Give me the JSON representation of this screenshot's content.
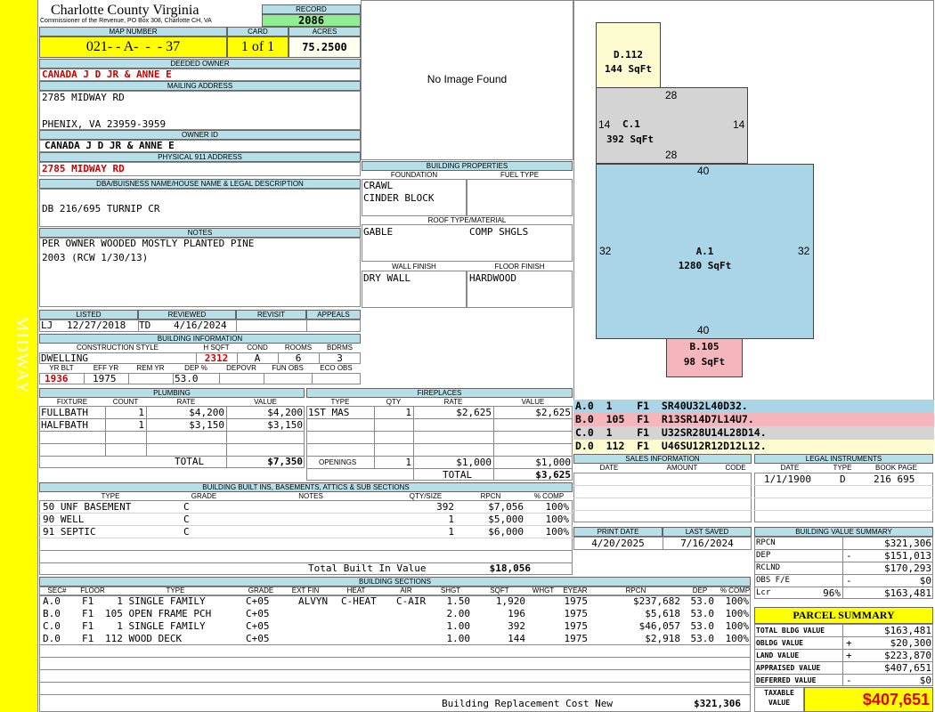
{
  "side_label": "MIDWAY",
  "header": {
    "county": "Charlotte County Virginia",
    "commissioner": "Commissioner of the Revenue, PO Box 308, Charlotte CH, VA",
    "record_label": "RECORD",
    "record": "2086",
    "map_number_label": "MAP NUMBER",
    "map_number": "021- - A-  -  - 37",
    "card_label": "CARD",
    "card": "1 of 1",
    "acres_label": "ACRES",
    "acres": "75.2500"
  },
  "owner": {
    "deeded_owner_label": "DEEDED OWNER",
    "deeded_owner": "CANADA J D JR & ANNE E",
    "mailing_label": "MAILING ADDRESS",
    "mailing_line1": "2785 MIDWAY RD",
    "mailing_line2": "PHENIX, VA 23959-3959",
    "owner_id_label": "OWNER ID",
    "owner_id": "CANADA J D JR & ANNE E",
    "physical_label": "PHYSICAL 911 ADDRESS",
    "physical": "2785 MIDWAY RD",
    "dba_label": "DBA/BUISNESS NAME/HOUSE NAME & LEGAL DESCRIPTION",
    "dba": "DB 216/695 TURNIP CR",
    "notes_label": "NOTES",
    "notes_line1": "PER OWNER WOODED MOSTLY PLANTED PINE",
    "notes_line2": "2003 (RCW 1/30/13)"
  },
  "image_text": "No Image Found",
  "listing": {
    "listed_label": "LISTED",
    "reviewed_label": "REVIEWED",
    "revisit_label": "REVISIT",
    "appeals_label": "APPEALS",
    "listed_by": "LJ",
    "listed_date": "12/27/2018",
    "reviewed_by": "TD",
    "reviewed_date": "4/16/2024"
  },
  "building_info": {
    "label": "BUILDING INFORMATION",
    "style_label": "CONSTRUCTION STYLE",
    "hsqft_label": "H SQFT",
    "cond_label": "COND",
    "rooms_label": "ROOMS",
    "bdrms_label": "BDRMS",
    "style": "DWELLING",
    "hsqft": "2312",
    "cond": "A",
    "rooms": "6",
    "bdrms": "3",
    "yrblt_label": "YR BLT",
    "effyr_label": "EFF YR",
    "remyr_label": "REM YR",
    "dep_label": "DEP %",
    "depovr_label": "DEPOVR",
    "funobs_label": "FUN OBS",
    "ecoobs_label": "ECO OBS",
    "yrblt": "1936",
    "effyr": "1975",
    "dep": "53.0"
  },
  "building_props": {
    "label": "BUILDING PROPERTIES",
    "foundation_label": "FOUNDATION",
    "fuel_label": "FUEL TYPE",
    "foundation1": "CRAWL",
    "foundation2": "CINDER BLOCK",
    "roof_label": "ROOF TYPE/MATERIAL",
    "roof_type": "GABLE",
    "roof_material": "COMP SHGLS",
    "wall_label": "WALL FINISH",
    "floor_label": "FLOOR FINISH",
    "wall": "DRY WALL",
    "floor": "HARDWOOD"
  },
  "plumbing": {
    "label": "PLUMBING",
    "headers": [
      "FIXTURE",
      "COUNT",
      "RATE",
      "VALUE"
    ],
    "rows": [
      {
        "fixture": "FULLBATH",
        "count": "1",
        "rate": "$4,200",
        "value": "$4,200"
      },
      {
        "fixture": "HALFBATH",
        "count": "1",
        "rate": "$3,150",
        "value": "$3,150"
      }
    ],
    "total_label": "TOTAL",
    "total": "$7,350"
  },
  "fireplaces": {
    "label": "FIREPLACES",
    "headers": [
      "TYPE",
      "QTY",
      "RATE",
      "VALUE"
    ],
    "rows": [
      {
        "type": "1ST MAS",
        "qty": "1",
        "rate": "$2,625",
        "value": "$2,625"
      }
    ],
    "openings_label": "OPENINGS",
    "openings_qty": "1",
    "openings_rate": "$1,000",
    "openings_value": "$1,000",
    "total_label": "TOTAL",
    "total": "$3,625"
  },
  "sketch": {
    "d": {
      "name": "D.112",
      "area": "144 SqFt"
    },
    "c": {
      "name": "C.1",
      "area": "392 SqFt",
      "top": "28",
      "bottom": "28",
      "left": "14",
      "right": "14"
    },
    "a": {
      "name": "A.1",
      "area": "1280 SqFt",
      "top": "40",
      "bottom": "40",
      "left": "32",
      "right": "32"
    },
    "b": {
      "name": "B.105",
      "area": "98 SqFt"
    },
    "dims_top_c": "28",
    "colors": {
      "a": "#a9d5e6",
      "b": "#f5b5bd",
      "c": "#d4d4d4",
      "d": "#fdfbd0"
    }
  },
  "sketch_codes": [
    {
      "text": "A.0  1    F1  SR40U32L40D32.",
      "color": "#a9d5e6"
    },
    {
      "text": "B.0  105  F1  R13SR14D7L14U7.",
      "color": "#f5b5bd"
    },
    {
      "text": "C.0  1    F1  U32SR28U14L28D14.",
      "color": "#d4d4d4"
    },
    {
      "text": "D.0  112  F1  U46SU12R12D12L12.",
      "color": "#fdfbd0"
    }
  ],
  "sales": {
    "label": "SALES INFORMATION",
    "headers": [
      "DATE",
      "AMOUNT",
      "CODE"
    ]
  },
  "legal": {
    "label": "LEGAL INSTRUMENTS",
    "headers": [
      "DATE",
      "TYPE",
      "BOOK PAGE"
    ],
    "date": "1/1/1900",
    "type": "D",
    "bookpage": "216 695"
  },
  "print": {
    "print_label": "PRINT DATE",
    "saved_label": "LAST SAVED",
    "print_date": "4/20/2025",
    "last_saved": "7/16/2024"
  },
  "built_ins": {
    "label": "BUILDING BUILT INS, BASEMENTS, ATTICS & SUB SECTIONS",
    "headers": [
      "TYPE",
      "GRADE",
      "NOTES",
      "QTY/SIZE",
      "RPCN",
      "% COMP"
    ],
    "rows": [
      {
        "type": "50 UNF BASEMENT",
        "grade": "C",
        "qty": "392",
        "rpcn": "$7,056",
        "comp": "100%"
      },
      {
        "type": "90 WELL",
        "grade": "C",
        "qty": "1",
        "rpcn": "$5,000",
        "comp": "100%"
      },
      {
        "type": "91 SEPTIC",
        "grade": "C",
        "qty": "1",
        "rpcn": "$6,000",
        "comp": "100%"
      }
    ],
    "total_label": "Total Built In Value",
    "total": "$18,056"
  },
  "bvs": {
    "label": "BUILDING VALUE SUMMARY",
    "rpcn_label": "RPCN",
    "rpcn": "$321,306",
    "dep_label": "DEP",
    "dep_sign": "-",
    "dep": "$151,013",
    "rclnd_label": "RCLND",
    "rclnd": "$170,293",
    "obs_label": "OBS F/E",
    "obs_sign": "-",
    "obs": "$0",
    "lcr_label": "Lcr",
    "lcr_pct": "96%",
    "lcr": "$163,481"
  },
  "sections": {
    "label": "BUILDING SECTIONS",
    "headers": [
      "SEC#",
      "FLOOR",
      "TYPE",
      "GRADE",
      "EXT FIN",
      "HEAT",
      "AIR",
      "SHGT",
      "SQFT",
      "WHGT",
      "EYEAR",
      "RPCN",
      "DEP",
      "% COMP"
    ],
    "rows": [
      {
        "sec": "A.0",
        "floor": "F1",
        "type": "  1 SINGLE FAMILY",
        "grade": "C+05",
        "ext": "ALVYN",
        "heat": "C-HEAT",
        "air": "C-AIR",
        "shgt": "1.50",
        "sqft": "1,920",
        "eyear": "1975",
        "rpcn": "$237,682",
        "dep": "53.0",
        "comp": "100%"
      },
      {
        "sec": "B.0",
        "floor": "F1",
        "type": "105 OPEN FRAME PCH",
        "grade": "C+05",
        "ext": "",
        "heat": "",
        "air": "",
        "shgt": "2.00",
        "sqft": "196",
        "eyear": "1975",
        "rpcn": "$5,618",
        "dep": "53.0",
        "comp": "100%"
      },
      {
        "sec": "C.0",
        "floor": "F1",
        "type": "  1 SINGLE FAMILY",
        "grade": "C+05",
        "ext": "",
        "heat": "",
        "air": "",
        "shgt": "1.00",
        "sqft": "392",
        "eyear": "1975",
        "rpcn": "$46,057",
        "dep": "53.0",
        "comp": "100%"
      },
      {
        "sec": "D.0",
        "floor": "F1",
        "type": "112 WOOD DECK",
        "grade": "C+05",
        "ext": "",
        "heat": "",
        "air": "",
        "shgt": "1.00",
        "sqft": "144",
        "eyear": "1975",
        "rpcn": "$2,918",
        "dep": "53.0",
        "comp": "100%"
      }
    ],
    "replacement_label": "Building Replacement Cost New",
    "replacement": "$321,306"
  },
  "parcel": {
    "label": "PARCEL SUMMARY",
    "bldg_label": "TOTAL BLDG VALUE",
    "bldg": "$163,481",
    "obldg_label": "OBLDG VALUE",
    "obldg_sign": "+",
    "obldg": "$20,300",
    "land_label": "LAND VALUE",
    "land_sign": "+",
    "land": "$223,870",
    "appraised_label": "APPRAISED VALUE",
    "appraised": "$407,651",
    "deferred_label": "DEFERRED VALUE",
    "deferred_sign": "-",
    "deferred": "$0",
    "taxable_label1": "TAXABLE",
    "taxable_label2": "VALUE",
    "taxable": "$407,651"
  }
}
